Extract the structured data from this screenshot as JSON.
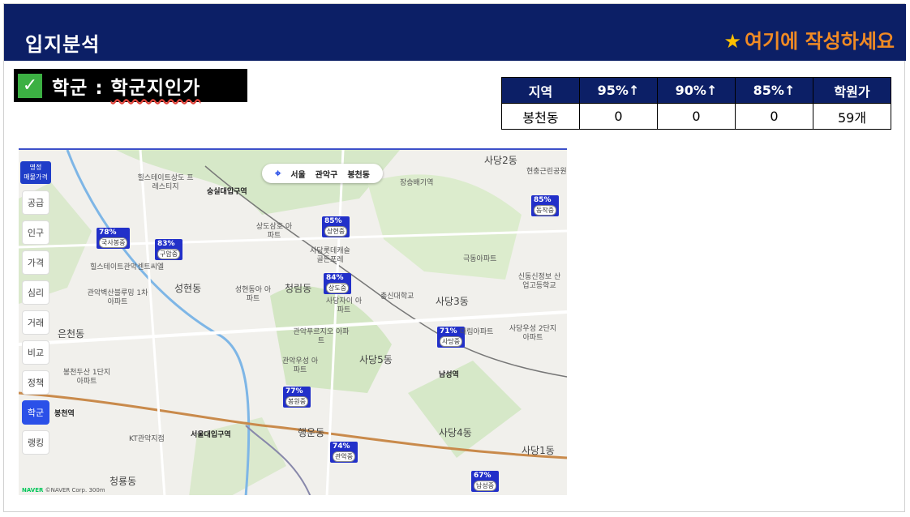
{
  "header": {
    "title": "입지분석",
    "note_star": "★",
    "note": "여기에 작성하세요"
  },
  "section": {
    "check": "✓",
    "label_prefix": "학군 : ",
    "label_main": "학군지인가"
  },
  "stats_table": {
    "headers": [
      "지역",
      "95%↑",
      "90%↑",
      "85%↑",
      "학원가"
    ],
    "rows": [
      [
        "봉천동",
        "0",
        "0",
        "0",
        "59개"
      ]
    ]
  },
  "map": {
    "sidebar_top": [
      "명정",
      "매물가격"
    ],
    "sidebar": [
      "공급",
      "인구",
      "가격",
      "심리",
      "거래",
      "비교",
      "정책",
      "학군",
      "랭킹"
    ],
    "active_sidebar": "학군",
    "breadcrumb": [
      "서울",
      "관악구",
      "봉천동"
    ],
    "school_pins": [
      {
        "pct": "78%",
        "name": "국사봉중"
      },
      {
        "pct": "83%",
        "name": "구암중"
      },
      {
        "pct": "85%",
        "name": "상현중"
      },
      {
        "pct": "84%",
        "name": "상도중"
      },
      {
        "pct": "71%",
        "name": "사당중"
      },
      {
        "pct": "85%",
        "name": "동작중"
      },
      {
        "pct": "77%",
        "name": "봉원중"
      },
      {
        "pct": "74%",
        "name": "관악중"
      },
      {
        "pct": "67%",
        "name": "남성중"
      }
    ],
    "districts": [
      "성현동",
      "청림동",
      "사당3동",
      "은천동",
      "사당5동",
      "사당2동",
      "사당4동",
      "사당1동",
      "행운동",
      "청룡동"
    ],
    "places": [
      "힐스테이트상도 프레스티지",
      "숭실대입구역",
      "장승배기역",
      "상도삼호 아파트",
      "사당롯데캐슬 골든포레",
      "극동아파트",
      "힐스테이트관악센트씨엘",
      "관악벽산블루밍 1차아파트",
      "성현동아 아파트",
      "사당자이 아파트",
      "관악푸르지오 아파트",
      "관악우성 아파트",
      "대림아파트",
      "사당우성 2단지아파트",
      "봉천두산 1단지아파트",
      "남성역",
      "봉천역",
      "서울대입구역",
      "KT관악지점",
      "현충근린공원",
      "신동신정보 산업고등학교",
      "총신대학교"
    ],
    "footer_brand": "NAVER",
    "footer_text": "©NAVER Corp.  300m"
  }
}
